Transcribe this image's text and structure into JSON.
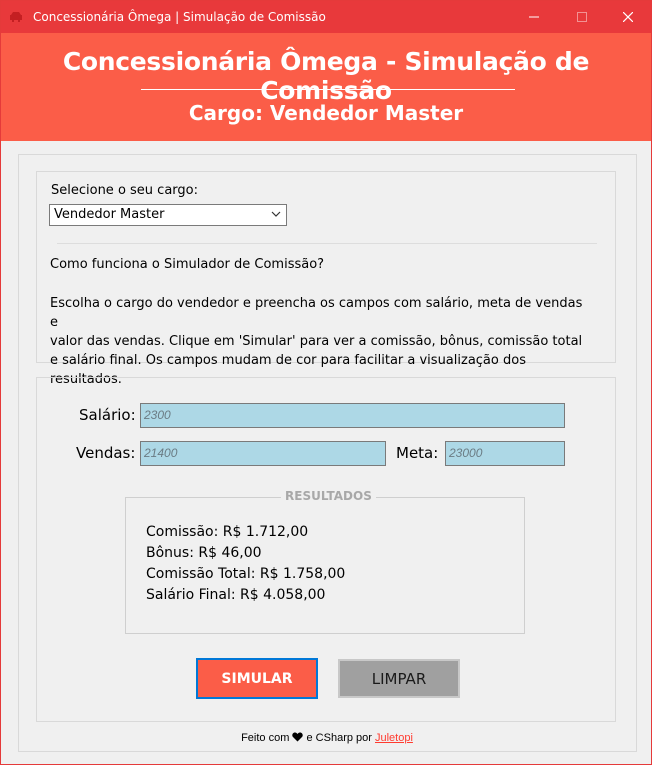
{
  "window": {
    "title": "Concessionária Ômega | Simulação de Comissão",
    "icons": {
      "app": "app-icon",
      "minimize": "minimize-icon",
      "maximize": "maximize-icon",
      "close": "close-icon"
    }
  },
  "header": {
    "title": "Concessionária Ômega - Simulação de Comissão",
    "cargo_title": "Cargo: Vendedor Master"
  },
  "cargo": {
    "label": "Selecione o seu cargo:",
    "selected": "Vendedor Master"
  },
  "how_it_works": {
    "title": "Como funciona o Simulador de Comissão?",
    "lines": [
      "Escolha o cargo do vendedor e preencha os campos com salário, meta de vendas e",
      "valor das vendas. Clique em 'Simular' para ver a comissão, bônus, comissão total",
      "e salário final. Os campos mudam de cor para facilitar a visualização dos resultados."
    ]
  },
  "form": {
    "salario_label": "Salário:",
    "salario_value": "2300",
    "vendas_label": "Vendas:",
    "vendas_value": "21400",
    "meta_label": "Meta:",
    "meta_value": "23000"
  },
  "results": {
    "legend": "RESULTADOS",
    "comissao": "Comissão: R$ 1.712,00",
    "bonus": "Bônus: R$ 46,00",
    "comissao_total": "Comissão Total: R$ 1.758,00",
    "salario_final": "Salário Final: R$ 4.058,00"
  },
  "buttons": {
    "simular": "SIMULAR",
    "limpar": "LIMPAR"
  },
  "footer": {
    "prefix": "Feito com",
    "suffix": "e CSharp por",
    "author": "Juletopi"
  },
  "colors": {
    "titlebar": "#e8393b",
    "header": "#fb5d48",
    "input_bg": "#add8e6",
    "limpar_bg": "#a0a0a0",
    "focus_border": "#0078d7",
    "link": "#ff3b30"
  }
}
